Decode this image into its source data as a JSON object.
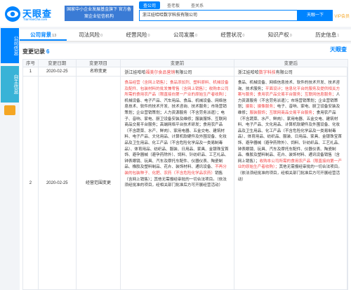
{
  "header": {
    "logo_text": "天眼查",
    "logo_sub": "TianYanCha.com",
    "banner": "国家中小企业发展基金旗下 官方备案企业征信机构",
    "search_tabs": [
      "查公司",
      "查老板",
      "查关系"
    ],
    "search_value": "浙江娃哈哈数字科技有限公司",
    "search_button": "天眼一下",
    "vip": "VIP会员"
  },
  "side": {
    "items": [
      "公司信息",
      "自主信息"
    ]
  },
  "tabs": [
    {
      "label": "公司背景",
      "count": "13",
      "active": true
    },
    {
      "label": "司法风险",
      "count": "0"
    },
    {
      "label": "经营风险",
      "count": "0"
    },
    {
      "label": "公司发展",
      "count": "0"
    },
    {
      "label": "经营状况",
      "count": "0"
    },
    {
      "label": "知识产权",
      "count": "0"
    },
    {
      "label": "历史信息",
      "count": "1"
    }
  ],
  "panel": {
    "title": "变更记录",
    "count": "6",
    "logo": "天眼查",
    "columns": [
      "序号",
      "变更日期",
      "变更项目",
      "变更前",
      "变更后"
    ],
    "rows": [
      {
        "index": "1",
        "date": "2020-02-25",
        "item": "名称变更",
        "before": [
          {
            "t": "浙江娃哈哈"
          },
          {
            "t": "福美尔食品营销",
            "hl": true
          },
          {
            "t": "有限公司"
          }
        ],
        "after": [
          {
            "t": "浙江娃哈哈"
          },
          {
            "t": "数字科技",
            "hl": true
          },
          {
            "t": "有限公司"
          }
        ]
      },
      {
        "index": "2",
        "date": "2020-02-25",
        "item": "经营范围变更",
        "before": [
          {
            "t": "食品经营（含网上销售）；食品添加剂、塑料原料、机械设备及配件、包装材料的批发兼零售（含网上销售）；收购本公司所需的食用农产品（限直接向第一产业的原始生产者收购）；",
            "hl": true
          },
          {
            "t": "机械设备、电子产品、汽车用品、"
          },
          {
            "t": "食品、机械设备、网络信息技术、软件的技术开发、技术咨询、技术服务；市场营销策划；企业营销策划；人力资源服务（不含劳务派遣）；电子、音响、家电、厨卫设备安装及维修；服装服饰、互联网商品交易平台服务；高端网络平台技术研发；食用农产品（不含蔬菜、水产、鲜肉）、家用电器、五金交电、建筑材料、电子产品、文化用品、计算机软硬件及外围设备、化妆品及卫生用品、化工产品（不含危险化学品及一类易制毒品）、体育用品、纺织品、服装、日用品、家具、金银珠宝首饰、避孕器械（避孕药除外）、饲料、针纺织品、工艺礼品、钟表眼镜、玩具、汽车及摩托车配件、仪器仪表、陶瓷制品、橡胶及塑料制品、花卉、装饰材料、通讯设备、",
            "hl": false
          },
          {
            "t": "不再分装的包装种子、化肥、农药（不含危险化学品农药）",
            "hl": true
          },
          {
            "t": "销售（含网上销售）；其他无需报经审批的一切合法项目。（依法须经批准的项目，经相关部门批准后方可开展经营活动）"
          }
        ],
        "after": [
          {
            "t": "食品、机械设备、网络信息技术、软件的技术开发、技术咨询、技术服务；"
          },
          {
            "t": "平面设计；信息化平台的服务及提供相关方案与服务；食用农产品交易平台服务；互联网信息服务；",
            "hl": true
          },
          {
            "t": "人力资源服务（不含劳务派遣）；市场营销策划；企业营销策划；"
          },
          {
            "t": "摄影；摄像服务；",
            "hl": true
          },
          {
            "t": "电子、音响、家电、厨卫设备安装及维修；"
          },
          {
            "t": "服装服饰；互联网商品交易平台服务；",
            "hl": true
          },
          {
            "t": "食用农产品（不含蔬菜、水产、鲜肉）、家用电器、五金交电、建筑材料、电子产品、文化用品、计算机软硬件及外围设备、化妆品及卫生用品、化工产品（不含危险化学品及一类易制毒品）、体育用品、纺织品、服装、日用品、家具、金银珠宝首饰、避孕器械（避孕药除外）、饲料、针纺织品、工艺礼品、钟表眼镜、玩具、汽车及摩托车配件、仪器仪表、陶瓷制品、橡胶及塑料制品、花卉、装饰材料、通讯设备销售（含网上销售）；"
          },
          {
            "t": "收购本公司所需的食用农产品（限直接向第一产业的原始生产者收购）；",
            "hl": true
          },
          {
            "t": "其他无需报经审批的一切合法项目。（依法须经批准的项目，经相关部门批准后方可开展经营活动）"
          }
        ]
      }
    ]
  }
}
